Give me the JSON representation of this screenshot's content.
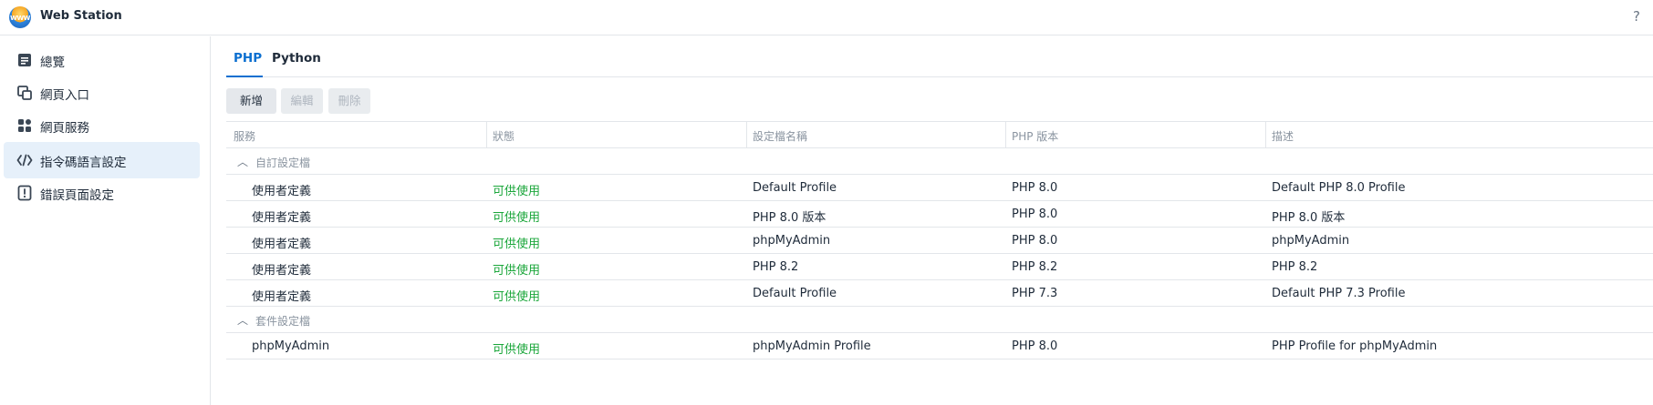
{
  "app": {
    "title": "Web Station",
    "logo_text": "WWW",
    "help_glyph": "?"
  },
  "sidebar": {
    "items": [
      {
        "label": "總覽",
        "icon": "overview-icon"
      },
      {
        "label": "網頁入口",
        "icon": "web-portal-icon"
      },
      {
        "label": "網頁服務",
        "icon": "web-service-icon"
      },
      {
        "label": "指令碼語言設定",
        "icon": "script-code-icon",
        "active": true
      },
      {
        "label": "錯誤頁面設定",
        "icon": "error-page-icon"
      }
    ]
  },
  "tabs": [
    {
      "label": "PHP",
      "active": true
    },
    {
      "label": "Python",
      "active": false
    }
  ],
  "toolbar": {
    "add_label": "新增",
    "edit_label": "編輯",
    "delete_label": "刪除"
  },
  "table": {
    "headers": [
      "服務",
      "狀態",
      "設定檔名稱",
      "PHP 版本",
      "描述"
    ],
    "groups": [
      {
        "label": "自訂設定檔",
        "rows": [
          [
            "使用者定義",
            "可供使用",
            "Default Profile",
            "PHP 8.0",
            "Default PHP 8.0 Profile"
          ],
          [
            "使用者定義",
            "可供使用",
            "PHP 8.0 版本",
            "PHP 8.0",
            "PHP 8.0 版本"
          ],
          [
            "使用者定義",
            "可供使用",
            "phpMyAdmin",
            "PHP 8.0",
            "phpMyAdmin"
          ],
          [
            "使用者定義",
            "可供使用",
            "PHP 8.2",
            "PHP 8.2",
            "PHP 8.2"
          ],
          [
            "使用者定義",
            "可供使用",
            "Default Profile",
            "PHP 7.3",
            "Default PHP 7.3 Profile"
          ]
        ]
      },
      {
        "label": "套件設定檔",
        "rows": [
          [
            "phpMyAdmin",
            "可供使用",
            "phpMyAdmin Profile",
            "PHP 8.0",
            "PHP Profile for phpMyAdmin"
          ]
        ]
      }
    ]
  },
  "colors": {
    "accent": "#0b6fd0",
    "status_ok": "#1aa63a",
    "active_nav_bg": "#e6f0fa"
  }
}
